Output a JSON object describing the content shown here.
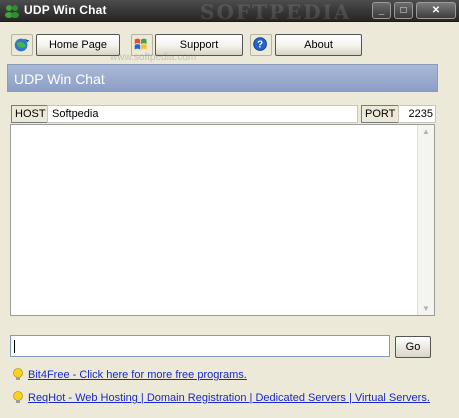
{
  "window": {
    "title": "UDP Win Chat",
    "watermark": "SOFTPEDIA"
  },
  "toolbar": {
    "home_label": "Home Page",
    "support_label": "Support",
    "about_label": "About",
    "watermark": "www.softpedia.com"
  },
  "banner": {
    "title": "UDP Win Chat"
  },
  "connection": {
    "host_label": "HOST",
    "host_value": "Softpedia",
    "port_label": "PORT",
    "port_value": "2235"
  },
  "message": {
    "go_label": "Go"
  },
  "links": [
    {
      "text": "Bit4Free - Click here for more free programs."
    },
    {
      "text": "ReqHot - Web Hosting | Domain Registration | Dedicated Servers | Virtual Servers."
    }
  ],
  "colors": {
    "banner": "#8c9fc6",
    "titlebar": "#2f2f2f",
    "link": "#1a29c6"
  }
}
